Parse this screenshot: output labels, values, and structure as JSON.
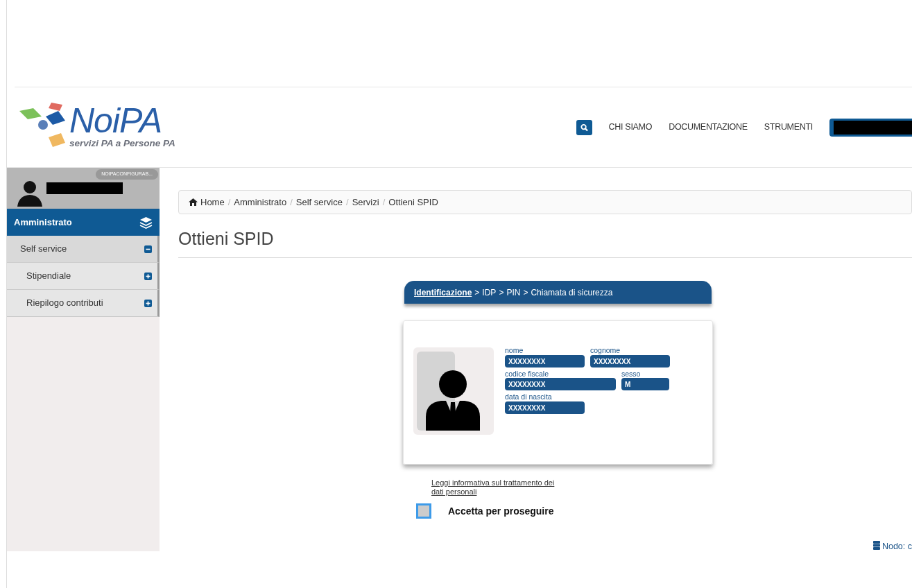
{
  "logo": {
    "title": "NoiPA",
    "tagline": "servizi PA a Persone PA"
  },
  "nav": {
    "links": [
      "CHI SIAMO",
      "DOCUMENTAZIONE",
      "STRUMENTI"
    ]
  },
  "sidebar": {
    "config_tag": "NOIPACONFIGURAB...",
    "section": "Amministrato",
    "items": [
      {
        "label": "Self service",
        "expanded": true,
        "children": [
          {
            "label": "Stipendiale",
            "expanded": false
          },
          {
            "label": "Riepilogo contributi",
            "expanded": false
          }
        ]
      }
    ]
  },
  "breadcrumb": {
    "separator": "/",
    "items": [
      "Home",
      "Amministrato",
      "Self service",
      "Servizi",
      "Ottieni SPID"
    ]
  },
  "page_title": "Ottieni SPID",
  "steps": {
    "separator": ">",
    "items": [
      {
        "label": "Identificazione",
        "selected": true
      },
      {
        "label": "IDP",
        "selected": false
      },
      {
        "label": "PIN",
        "selected": false
      },
      {
        "label": "Chiamata di sicurezza",
        "selected": false
      }
    ]
  },
  "id_card": {
    "rows": [
      [
        {
          "label": "nome",
          "value": "XXXXXXXX",
          "kind": "normal"
        },
        {
          "label": "cognome",
          "value": "XXXXXXXX",
          "kind": "normal"
        }
      ],
      [
        {
          "label": "codice fiscale",
          "value": "XXXXXXXX",
          "kind": "wide"
        },
        {
          "label": "sesso",
          "value": "M",
          "kind": "short"
        }
      ],
      [
        {
          "label": "data di nascita",
          "value": "XXXXXXXX",
          "kind": "normal"
        }
      ]
    ]
  },
  "privacy_link": "Leggi informativa sul trattamento dei dati personali",
  "accept": {
    "label": "Accetta per proseguire",
    "checked": false
  },
  "footer": {
    "node": "Nodo: c"
  }
}
